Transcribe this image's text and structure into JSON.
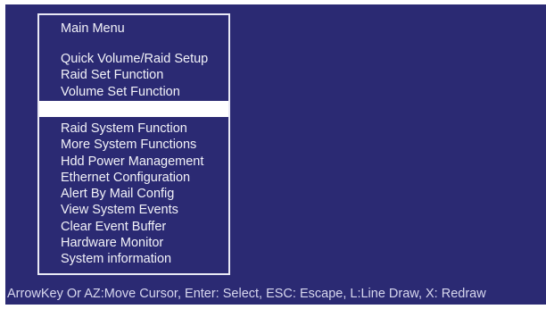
{
  "menu": {
    "title": "Main Menu",
    "items_top": [
      "Quick Volume/Raid Setup",
      "Raid Set Function",
      "Volume Set Function"
    ],
    "items_bottom": [
      "Raid System Function",
      "More System Functions",
      "Hdd Power Management",
      "Ethernet Configuration",
      "Alert By Mail Config",
      "View System Events",
      "Clear Event Buffer",
      "Hardware Monitor",
      "System information"
    ]
  },
  "status_bar": {
    "text": "ArrowKey Or AZ:Move Cursor, Enter: Select, ESC: Escape, L:Line Draw, X: Redraw"
  },
  "colors": {
    "background": "#2b2a73",
    "text": "#f2f2f8",
    "highlight": "#ffffff"
  }
}
